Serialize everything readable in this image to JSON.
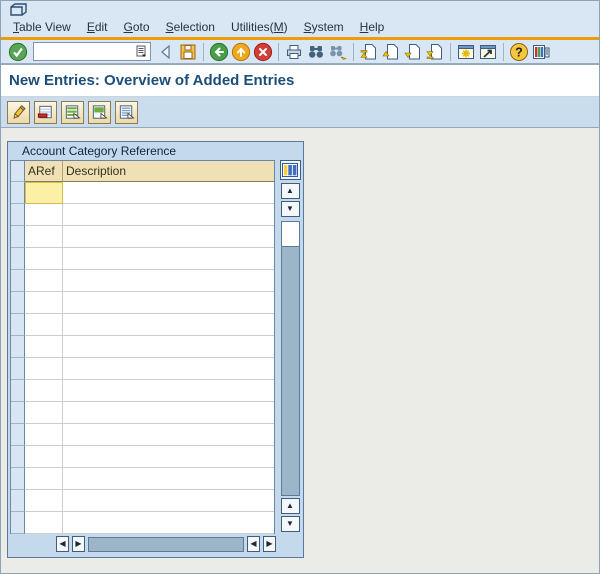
{
  "menu_bar": {
    "items": [
      {
        "pre": "",
        "u": "T",
        "rest": "able View"
      },
      {
        "pre": "",
        "u": "E",
        "rest": "dit"
      },
      {
        "pre": "",
        "u": "G",
        "rest": "oto"
      },
      {
        "pre": "",
        "u": "S",
        "rest": "election"
      },
      {
        "pre": "Utilities(",
        "u": "M",
        "rest": ")"
      },
      {
        "pre": "",
        "u": "S",
        "rest": "ystem"
      },
      {
        "pre": "",
        "u": "H",
        "rest": "elp"
      }
    ]
  },
  "toolbar": {
    "command_field": {
      "value": ""
    },
    "buttons": [
      {
        "name": "enter",
        "icon": "green-check-circle-icon"
      },
      {
        "name": "back",
        "icon": "left-triangle-icon"
      },
      {
        "name": "save",
        "icon": "floppy-disk-icon"
      },
      {
        "name": "back-nav",
        "icon": "green-left-arrow-circle-icon"
      },
      {
        "name": "exit",
        "icon": "yellow-up-arrow-circle-icon"
      },
      {
        "name": "cancel",
        "icon": "red-x-circle-icon"
      },
      {
        "name": "print",
        "icon": "printer-icon"
      },
      {
        "name": "find",
        "icon": "binoculars-icon"
      },
      {
        "name": "find-next",
        "icon": "binoculars-plus-icon"
      },
      {
        "name": "first-page",
        "icon": "page-first-icon"
      },
      {
        "name": "previous-page",
        "icon": "page-up-icon"
      },
      {
        "name": "next-page",
        "icon": "page-down-icon"
      },
      {
        "name": "last-page",
        "icon": "page-last-icon"
      },
      {
        "name": "new-session",
        "icon": "window-burst-icon"
      },
      {
        "name": "create-shortcut",
        "icon": "window-arrow-icon"
      },
      {
        "name": "help",
        "icon": "question-circle-icon"
      },
      {
        "name": "customize-layout",
        "icon": "layout-grid-icon"
      }
    ]
  },
  "page": {
    "title": "New Entries: Overview of Added Entries"
  },
  "app_toolbar": {
    "buttons": [
      {
        "name": "change",
        "icon": "pencil-icon"
      },
      {
        "name": "delete-row",
        "icon": "table-row-minus-icon"
      },
      {
        "name": "select-all",
        "icon": "table-select-all-icon"
      },
      {
        "name": "select-block",
        "icon": "table-select-block-icon"
      },
      {
        "name": "deselect-all",
        "icon": "table-deselect-all-icon"
      }
    ]
  },
  "table": {
    "caption": "Account Category Reference",
    "columns": [
      {
        "label": "ARef"
      },
      {
        "label": "Description"
      }
    ],
    "active_cell": {
      "row": 0,
      "col": "aref"
    },
    "config_button_icon": "column-config-icon",
    "rows": [
      {
        "aref": "",
        "description": ""
      },
      {
        "aref": "",
        "description": ""
      },
      {
        "aref": "",
        "description": ""
      },
      {
        "aref": "",
        "description": ""
      },
      {
        "aref": "",
        "description": ""
      },
      {
        "aref": "",
        "description": ""
      },
      {
        "aref": "",
        "description": ""
      },
      {
        "aref": "",
        "description": ""
      },
      {
        "aref": "",
        "description": ""
      },
      {
        "aref": "",
        "description": ""
      },
      {
        "aref": "",
        "description": ""
      },
      {
        "aref": "",
        "description": ""
      },
      {
        "aref": "",
        "description": ""
      },
      {
        "aref": "",
        "description": ""
      },
      {
        "aref": "",
        "description": ""
      },
      {
        "aref": "",
        "description": ""
      }
    ]
  },
  "colors": {
    "accent_orange": "#ee9c0a",
    "top_bar_blue": "#d9e6f3",
    "app_toolbar_blue": "#c9ddef",
    "panel_blue": "#c5d9ec",
    "column_header_tan": "#efe1b5",
    "active_cell_yellow": "#fcf0a6",
    "title_blue": "#1d4e79",
    "main_gray": "#ebebe7",
    "scroll_thumb": "#9cb5c9"
  }
}
